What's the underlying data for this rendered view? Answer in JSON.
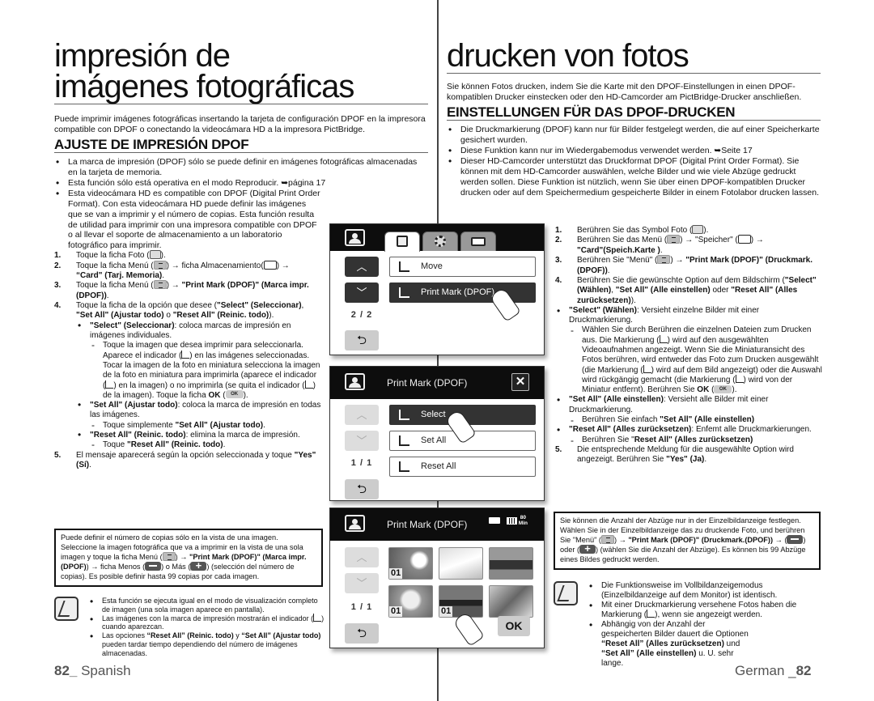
{
  "left": {
    "title_line1": "impresión de",
    "title_line2": "imágenes fotográficas",
    "intro": "Puede imprimir imágenes fotográficas insertando la tarjeta de configuración DPOF en la impresora compatible con DPOF o conectando la videocámara HD a la impresora PictBridge.",
    "section_heading": "AJUSTE DE IMPRESIÓN DPOF",
    "bullets": [
      "La marca de impresión (DPOF) sólo se puede definir en imágenes fotográficas almacenadas en la tarjeta de memoria.",
      "Esta función sólo está operativa en el modo Reproducir. ➥página 17",
      "Esta videocámara HD es compatible con DPOF (Digital Print Order Format). Con esta videocámara HD puede definir las imágenes que se van a imprimir y el número de copias. Esta función resulta de utilidad para imprimir con una impresora compatible con DPOF o al llevar el soporte de almacenamiento a un laboratorio fotográfico para imprimir."
    ],
    "steps": {
      "s1_num": "1.",
      "s1_text": "Toque la ficha Foto (",
      "s1_end": ").",
      "s2_num": "2.",
      "s2_a": "Toque la ficha Menú (",
      "s2_b": ") → ficha Almacenamiento(",
      "s2_c": ") →",
      "s2_bold": "“Card\" (Tarj. Memoria)",
      "s2_end": ".",
      "s3_num": "3.",
      "s3_a": "Toque la ficha Menú (",
      "s3_b": ") → ",
      "s3_bold": "\"Print Mark (DPOF)\" (Marca impr.(DPOF))",
      "s3_end": ".",
      "s4_num": "4.",
      "s4_a": "Toque la ficha de la opción que desee (",
      "s4_bold1": "\"Select\" (Seleccionar)",
      "s4_sep1": ", ",
      "s4_bold2": "\"Set All\" (Ajustar todo)",
      "s4_sep2": " o ",
      "s4_bold3": "\"Reset All\" (Reinic. todo)",
      "s4_end": ").",
      "sub_select_bold": "\"Select\" (Seleccionar)",
      "sub_select_text": ": coloca marcas de impresión en imágenes individuales.",
      "dash_select_a": "Toque la imagen que desea imprimir para seleccionarla. Aparece el indicador (",
      "dash_select_b": ") en las imágenes seleccionadas. Tocar la imagen de la foto en miniatura selecciona la imagen de la foto en miniatura para imprimirla (aparece el indicador (",
      "dash_select_c": ") en la imagen) o no imprimirla (se quita el indicador (",
      "dash_select_d": ") de la imagen). Toque la ficha ",
      "dash_select_ok": "OK",
      "dash_select_e": " (",
      "dash_select_f": ").",
      "sub_setall_bold": "\"Set All\" (Ajustar todo)",
      "sub_setall_text": ": coloca la marca de impresión en todas las imágenes.",
      "dash_setall_a": "Toque simplemente ",
      "dash_setall_bold": "\"Set All\" (Ajustar todo)",
      "dash_setall_end": ".",
      "sub_resetall_bold": "\"Reset All\" (Reinic. todo)",
      "sub_resetall_text": ": elimina la marca de impresión.",
      "dash_resetall_a": "Toque ",
      "dash_resetall_bold": "\"Reset All\" (Reinic. todo)",
      "dash_resetall_end": ".",
      "s5_num": "5.",
      "s5_a": "El mensaje aparecerá según la opción seleccionada y toque ",
      "s5_bold": "\"Yes\" (Sí)",
      "s5_end": "."
    },
    "note": {
      "a": "Puede definir el número de copias sólo en la vista de una imagen. Seleccione la imagen fotográfica que va a imprimir en la vista de una sola imagen  y toque la ficha Menú (",
      "b": ") → ",
      "bold1": "\"Print Mark (DPOF)\" (Marca impr.(DPOF)",
      "c": ") → ficha Menos (",
      "d": ") o Más (",
      "e": ") (selección del número de copias). Es posible definir hasta 99 copias por cada imagen."
    },
    "memo": {
      "b1": "Esta función se ejecuta igual en el modo de visualización completo de imagen (una sola imagen aparece en pantalla).",
      "b2_a": "Las imágenes con la marca de impresión mostrarán el indicador (",
      "b2_b": ") cuando aparezcan.",
      "b3_a": "Las opciones ",
      "b3_bold1": "“Reset All” (Reinic. todo)",
      "b3_b": " y ",
      "b3_bold2": "“Set All” (Ajustar todo)",
      "b3_c": " pueden tardar tiempo dependiendo del número de imágenes almacenadas."
    },
    "footer_num": "82_",
    "footer_lang": " Spanish"
  },
  "right": {
    "title": "drucken von fotos",
    "intro": "Sie können Fotos drucken, indem Sie die Karte mit den DPOF-Einstellungen in einen DPOF-kompatiblen Drucker einstecken oder den HD-Camcorder am PictBridge-Drucker anschließen.",
    "section_heading": "EINSTELLUNGEN FÜR DAS DPOF-DRUCKEN",
    "bullets": [
      "Die Druckmarkierung (DPOF) kann nur für Bilder festgelegt werden, die auf einer Speicherkarte gesichert wurden.",
      "Diese Funktion kann nur im Wiedergabemodus verwendet werden. ➥Seite 17",
      "Dieser HD-Camcorder unterstützt das Druckformat DPOF (Digital Print Order Format). Sie können mit dem HD-Camcorder auswählen, welche Bilder und wie viele Abzüge gedruckt werden sollen. Diese Funktion ist nützlich, wenn Sie über einen DPOF-kompatiblen Drucker drucken oder auf dem Speichermedium gespeicherte Bilder in einem Fotolabor drucken lassen."
    ],
    "steps": {
      "s1_num": "1.",
      "s1_text": "Berühren Sie das Symbol Foto (",
      "s1_end": ").",
      "s2_num": "2.",
      "s2_a": "Berühren Sie das Menü  (",
      "s2_b": ") → \"Speicher\" (",
      "s2_c": ") →",
      "s2_bold": "\"Card\"(Speich.Karte )",
      "s2_end": ".",
      "s3_num": "3.",
      "s3_a": "Berühren Sie \"Menü\" (",
      "s3_b": ") → ",
      "s3_bold": "\"Print Mark (DPOF)\" (Druckmark.(DPOF))",
      "s3_end": ".",
      "s4_num": "4.",
      "s4_a": "Berühren Sie die gewünschte Option auf dem Bildschirm (",
      "s4_bold1": "\"Select\" (Wählen)",
      "s4_sep1": ", ",
      "s4_bold2": "\"Set All\" (Alle einstellen)",
      "s4_sep2": " oder ",
      "s4_bold3": "\"Reset All\" (Alles zurücksetzen)",
      "s4_end": ").",
      "b_select_bold": "\"Select\" (Wählen)",
      "b_select_text": ": Versieht einzelne Bilder mit einer Druckmarkierung.",
      "dash_select_a": "Wählen Sie durch Berühren die einzelnen Dateien zum Drucken aus. Die Markierung (",
      "dash_select_b": ") wird auf den ausgewählten Videoaufnahmen angezeigt. Wenn Sie die Miniaturansicht des Fotos berühren, wird entweder das Foto zum Drucken ausgewählt (die Markierung (",
      "dash_select_c": ") wird auf dem Bild angezeigt) oder die Auswahl wird rückgängig gemacht (die Markierung (",
      "dash_select_d": ") wird von der Miniatur entfernt). Berühren Sie ",
      "dash_select_ok": "OK",
      "dash_select_e": " (",
      "dash_select_f": ").",
      "b_setall_bold": "\"Set All\" (Alle einstellen)",
      "b_setall_text": ": Versieht alle Bilder mit einer Druckmarkierung.",
      "dash_setall_a": "Berühren Sie einfach ",
      "dash_setall_bold": "\"Set All\" (Alle einstellen)",
      "b_resetall_bold": "\"Reset All\" (Alles zurücksetzen)",
      "b_resetall_text": ": Enfemt alle Druckmarkierungen.",
      "dash_resetall_a": "Berühren Sie \"",
      "dash_resetall_bold": "Reset All\" (Alles zurücksetzen)",
      "s5_num": "5.",
      "s5_a": "Die entsprechende Meldung für die ausgewählte Option wird angezeigt. Berühren Sie ",
      "s5_bold": "\"Yes\" (Ja)",
      "s5_end": "."
    },
    "note": {
      "a": "Sie können die Anzahl der Abzüge nur in der Einzelbildanzeige festlegen. Wählen Sie in der Einzelbildanzeige das zu druckende Foto, und berühren Sie \"Menü\" (",
      "b": ") → ",
      "bold1": "\"Print Mark (DPOF)\" (Druckmark.(DPOF))",
      "c": " →  (",
      "d": ") oder  (",
      "e": ") (wählen Sie die Anzahl der Abzüge). Es können bis 99 Abzüge eines Bildes gedruckt werden."
    },
    "memo": {
      "b1": "Die Funktionsweise im Vollbildanzeigemodus (Einzelbildanzeige auf dem Monitor) ist identisch.",
      "b2_a": "Mit einer Druckmarkierung versehene Fotos haben die Markierung (",
      "b2_b": "), wenn sie angezeigt werden.",
      "b3_a": "Abhängig von der Anzahl der gespeicherten Bilder dauert die Optionen ",
      "b3_bold1": "“Reset All” (Alles zurücksetzen)",
      "b3_b": " und ",
      "b3_bold2": "“Set All” (Alle einstellen)",
      "b3_c": " u. U. sehr lange."
    },
    "footer_lang": "German _",
    "footer_num": "82"
  },
  "screens": {
    "menu": {
      "page": "2 / 2",
      "options": [
        "Move",
        "Print Mark (DPOF)"
      ],
      "selected_index": 1
    },
    "dpof": {
      "title": "Print Mark (DPOF)",
      "page": "1 / 1",
      "options": [
        "Select",
        "Set All",
        "Reset All"
      ],
      "selected_index": 0
    },
    "thumbs": {
      "title": "Print Mark (DPOF)",
      "remaining": "80",
      "remaining_unit": "Min",
      "page": "1 / 1",
      "badges": [
        "01",
        "",
        "",
        "01",
        "01",
        ""
      ],
      "ok_label": "OK"
    }
  }
}
